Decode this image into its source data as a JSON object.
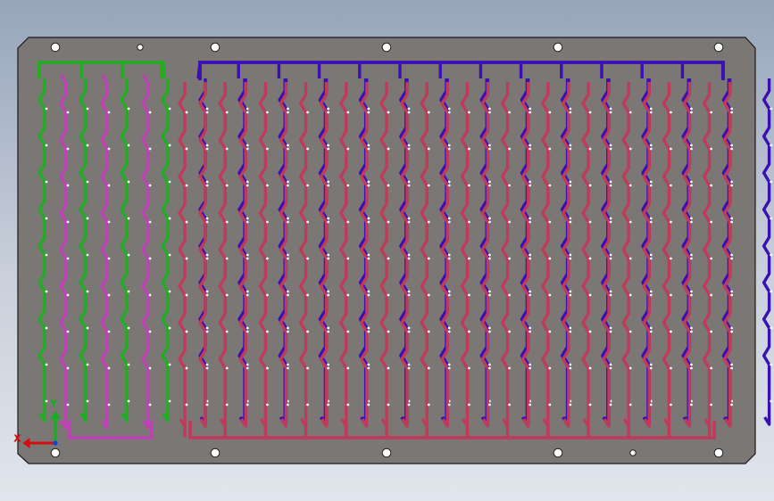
{
  "viewport": {
    "background": "gradient-gray-blue"
  },
  "plate": {
    "fill": "#7a7774",
    "outline": "#1a1a1a",
    "shape": "chamfered-rectangle"
  },
  "mounting_holes": {
    "top_count": 6,
    "bottom_count": 6
  },
  "circuits": [
    {
      "name": "green-manifold",
      "color": "#1fae1f",
      "channel_count": 4
    },
    {
      "name": "magenta-return",
      "color": "#c040b8",
      "channel_count": 3
    },
    {
      "name": "blue-manifold",
      "color": "#3a10b4",
      "channel_count": 14
    },
    {
      "name": "red-return",
      "color": "#c03a5c",
      "channel_count": 14
    }
  ],
  "triad": {
    "x_label": "X",
    "y_label": "Y",
    "x_color": "#d01010",
    "y_color": "#10b020",
    "z_color": "#1040e0"
  }
}
